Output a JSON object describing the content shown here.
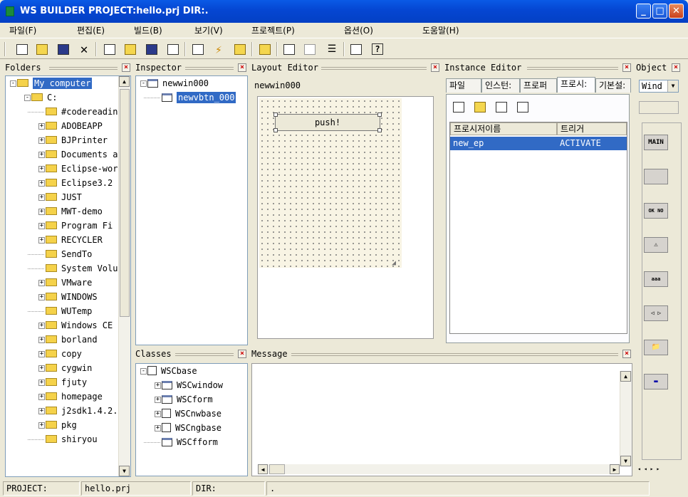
{
  "window": {
    "title": "WS BUILDER PROJECT:hello.prj DIR:."
  },
  "menu": [
    "파일(F)",
    "편집(E)",
    "빌드(B)",
    "보기(V)",
    "프로젝트(P)",
    "옵션(O)",
    "도움말(H)"
  ],
  "panels": {
    "folders": {
      "title": "Folders",
      "items": [
        {
          "label": "My computer",
          "level": 0,
          "expand": "-",
          "selected": true
        },
        {
          "label": "C:",
          "level": 1,
          "expand": "-"
        },
        {
          "label": "#codereadin",
          "level": 2,
          "expand": ""
        },
        {
          "label": "ADOBEAPP",
          "level": 2,
          "expand": "+"
        },
        {
          "label": "BJPrinter",
          "level": 2,
          "expand": "+"
        },
        {
          "label": "Documents a",
          "level": 2,
          "expand": "+"
        },
        {
          "label": "Eclipse-wor",
          "level": 2,
          "expand": "+"
        },
        {
          "label": "Eclipse3.2",
          "level": 2,
          "expand": "+"
        },
        {
          "label": "JUST",
          "level": 2,
          "expand": "+"
        },
        {
          "label": "MWT-demo",
          "level": 2,
          "expand": "+"
        },
        {
          "label": "Program Fi",
          "level": 2,
          "expand": "+"
        },
        {
          "label": "RECYCLER",
          "level": 2,
          "expand": "+"
        },
        {
          "label": "SendTo",
          "level": 2,
          "expand": ""
        },
        {
          "label": "System Volu",
          "level": 2,
          "expand": ""
        },
        {
          "label": "VMware",
          "level": 2,
          "expand": "+"
        },
        {
          "label": "WINDOWS",
          "level": 2,
          "expand": "+"
        },
        {
          "label": "WUTemp",
          "level": 2,
          "expand": ""
        },
        {
          "label": "Windows CE",
          "level": 2,
          "expand": "+"
        },
        {
          "label": "borland",
          "level": 2,
          "expand": "+"
        },
        {
          "label": "copy",
          "level": 2,
          "expand": "+"
        },
        {
          "label": "cygwin",
          "level": 2,
          "expand": "+"
        },
        {
          "label": "fjuty",
          "level": 2,
          "expand": "+"
        },
        {
          "label": "homepage",
          "level": 2,
          "expand": "+"
        },
        {
          "label": "j2sdk1.4.2.",
          "level": 2,
          "expand": "+"
        },
        {
          "label": "pkg",
          "level": 2,
          "expand": "+"
        },
        {
          "label": "shiryou",
          "level": 2,
          "expand": ""
        }
      ]
    },
    "inspector": {
      "title": "Inspector",
      "items": [
        {
          "label": "newwin000",
          "level": 0,
          "expand": "-"
        },
        {
          "label": "newvbtn_000",
          "level": 1,
          "expand": "",
          "selected": true
        }
      ]
    },
    "layout": {
      "title": "Layout Editor",
      "window_name": "newwin000",
      "button_label": "push!"
    },
    "instance": {
      "title": "Instance Editor",
      "tabs": [
        "파일",
        "인스턴:",
        "프로퍼",
        "프로시:",
        "기본설:"
      ],
      "active_tab": 3,
      "columns": [
        "프로시저이름",
        "트리거"
      ],
      "rows": [
        {
          "name": "new_ep",
          "trigger": "ACTIVATE"
        }
      ]
    },
    "object": {
      "title": "Object",
      "select_value": "Wind",
      "buttons": [
        "MAIN",
        "",
        "OK NO",
        "⚠",
        "aaa",
        "◁ ▷",
        "📁",
        "▬"
      ]
    },
    "classes": {
      "title": "Classes",
      "items": [
        {
          "label": "WSCbase",
          "level": 0,
          "expand": "-",
          "icon": "doc"
        },
        {
          "label": "WSCwindow",
          "level": 1,
          "expand": "+",
          "icon": "win"
        },
        {
          "label": "WSCform",
          "level": 1,
          "expand": "+",
          "icon": "win"
        },
        {
          "label": "WSCnwbase",
          "level": 1,
          "expand": "+",
          "icon": "doc"
        },
        {
          "label": "WSCngbase",
          "level": 1,
          "expand": "+",
          "icon": "doc"
        },
        {
          "label": "WSCfform",
          "level": 1,
          "expand": "",
          "icon": "win"
        }
      ]
    },
    "message": {
      "title": "Message"
    }
  },
  "status": {
    "project_label": "PROJECT:",
    "project_value": "hello.prj",
    "dir_label": "DIR:",
    "dir_value": "."
  }
}
